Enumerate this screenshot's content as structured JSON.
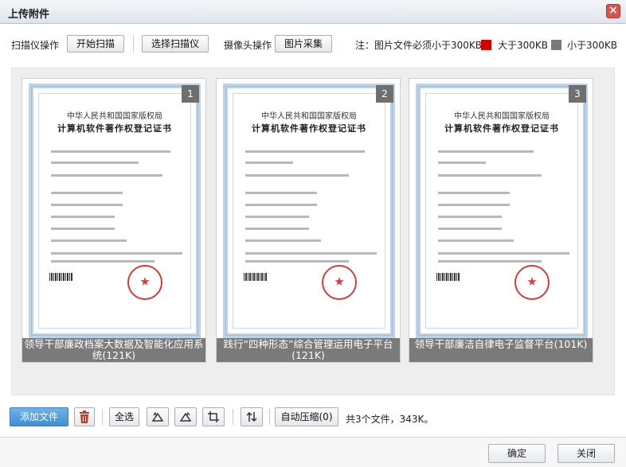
{
  "dialog": {
    "title": "上传附件",
    "close_icon": "close-icon"
  },
  "toolbar": {
    "scanner_label": "扫描仪操作",
    "start_scan": "开始扫描",
    "select_scanner": "选择扫描仪",
    "camera_label": "摄像头操作",
    "capture": "图片采集",
    "note": "注：图片文件必须小于300KB",
    "legend_large": "大于300KB",
    "legend_small": "小于300KB",
    "legend_large_color": "#d40000",
    "legend_small_color": "#7a7a7a"
  },
  "gallery": {
    "items": [
      {
        "index": "1",
        "caption": "领导干部廉政档案大数据及智能化应用系统(121K)",
        "cert_org": "中华人民共和国国家版权局",
        "cert_title": "计算机软件著作权登记证书"
      },
      {
        "index": "2",
        "caption": "践行“四种形态”综合管理运用电子平台(121K)",
        "cert_org": "中华人民共和国国家版权局",
        "cert_title": "计算机软件著作权登记证书"
      },
      {
        "index": "3",
        "caption": "领导干部廉洁自律电子监督平台(101K)",
        "cert_org": "中华人民共和国国家版权局",
        "cert_title": "计算机软件著作权登记证书"
      }
    ]
  },
  "actions": {
    "add_file": "添加文件",
    "select_all": "全选",
    "auto_compress": "自动压缩(0)",
    "summary": "共3个文件，343K。"
  },
  "footer": {
    "ok": "确定",
    "close": "关闭"
  }
}
